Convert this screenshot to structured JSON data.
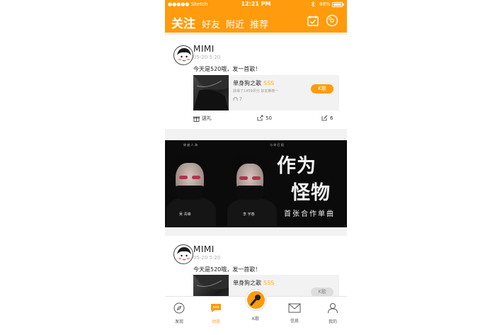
{
  "status": {
    "carrier": "●●●●● Sketch",
    "time": "12:21 PM",
    "battery": "88%"
  },
  "header": {
    "tabs": [
      {
        "label": "关注",
        "active": true
      },
      {
        "label": "好友",
        "active": false
      },
      {
        "label": "附近",
        "active": false
      },
      {
        "label": "推荐",
        "active": false
      }
    ],
    "icons": [
      "checkin-calendar-icon",
      "vinyl-record-icon"
    ]
  },
  "posts": [
    {
      "user": "MIMI",
      "time": "05-20 5:20",
      "text": "今天是520哦，发一首歌！",
      "song": {
        "title": "单身狗之歌",
        "grade": "SSS",
        "sub": "获得了1459评分  好友推荐一",
        "plays": "7",
        "button": "K歌"
      },
      "actions": {
        "gift": "送礼",
        "share": "50",
        "comment": "6"
      }
    },
    {
      "user": "MIMI",
      "time": "05-20 5:20",
      "text": "今天是520哦，发一首歌！",
      "song": {
        "title": "单身狗之歌",
        "grade": "SSS",
        "button": "K歌"
      }
    }
  ],
  "banner": {
    "top_left": "穿   越   人   海",
    "top_right": "与   你   匹   配",
    "line1": "作为",
    "line2": "怪物",
    "subtitle": "首张合作单曲",
    "name_left": "吴 青峰",
    "name_right": "李 宇春"
  },
  "nav": {
    "discover": "发现",
    "feed": "动态",
    "ksong": "K歌",
    "messages": "信息",
    "me": "我的"
  },
  "colors": {
    "accent": "#ff9b0c",
    "grade": "#ffae1a"
  }
}
